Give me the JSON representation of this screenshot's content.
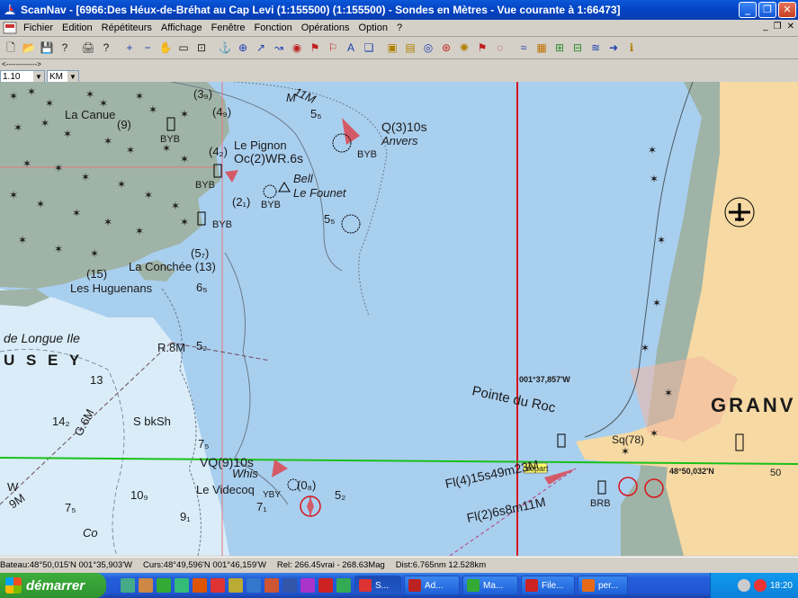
{
  "window": {
    "title": "ScanNav - [6966:Des Héux-de-Bréhat au Cap Levi (1:155500) (1:155500) - Sondes en  Mètres  - Vue courante à 1:66473]",
    "min_glyph": "_",
    "max_glyph": "❐",
    "close_glyph": "✕"
  },
  "menu": {
    "items": [
      "Fichier",
      "Edition",
      "Répétiteurs",
      "Affichage",
      "Fenêtre",
      "Fonction",
      "Opérations",
      "Option",
      "?"
    ],
    "mdi_min": "_",
    "mdi_restore": "❐",
    "mdi_close": "✕"
  },
  "toolbar": {
    "icons": [
      "new-chart-icon",
      "open-chart-icon",
      "save-icon",
      "help-icon",
      "print-icon",
      "pointer-help-icon",
      "zoom-in-icon",
      "zoom-out-icon",
      "hand-icon",
      "select-rect-icon",
      "select-zoom-icon",
      "boat-icon",
      "crosshair-icon",
      "route-icon",
      "track-icon",
      "mark-icon",
      "waypoint-icon",
      "waypoint2-icon",
      "text-icon",
      "layers-icon",
      "gps-icon",
      "nmea-icon",
      "compass-icon",
      "target-icon",
      "rose-icon",
      "flag-icon",
      "lifebuoy-icon",
      "tides-icon",
      "chart-icon",
      "grid-icon",
      "grid2-icon",
      "wind-icon",
      "arrow-icon",
      "info-icon"
    ]
  },
  "scale": {
    "ruler_label": "<------------->",
    "zoom_value": "1.10",
    "unit_value": "KM"
  },
  "map": {
    "labels": {
      "la_canue": "La Canue",
      "la_canue_depth": "(9)",
      "le_pignon": "Le Pignon",
      "oc_light": "Oc(2)WR.6s",
      "bell": "Bell",
      "le_founet": "Le Founet",
      "q_light": "Q(3)10s",
      "anvers": "Anvers",
      "byb_1": "BYB",
      "byb_2": "BYB",
      "byb_3": "BYB",
      "byb_4": "BYB",
      "byb_5": "BYB",
      "la_conchee": "La Conchée (13)",
      "les_huguenans": "Les Huguenans",
      "huguenans_depth": "(15)",
      "de_longue_ile": "de Longue Ile",
      "chausey": "U S E Y",
      "r8m": "R.8M",
      "g6m": "G.6M",
      "s_bksh": "S bkSh",
      "vq_light": "VQ(9)10s",
      "whis": "Whis",
      "le_videcoq": "Le Videcoq",
      "ybv": "YBY",
      "pointe_du_roc": "Pointe du Roc",
      "sq": "Sq(78)",
      "fl4": "Fl(4)15s49m23M",
      "fl2": "Fl(2)6s8m11M",
      "brb": "BRB",
      "depart": "départ",
      "granville": "GRANV",
      "lon_readout": "001°37,857'W",
      "lat_readout": "48°50,032'N",
      "w9m": "9M",
      "w_letter": "W",
      "co": "Co",
      "depth_75": "7₅",
      "depth_13": "13",
      "depth_14": "14₂",
      "depth_10": "10₉",
      "depth_91": "9₁",
      "depth_71": "7₁",
      "depth_52a": "5₂",
      "depth_52b": "5₂",
      "depth_08": "(0₈)",
      "depth_75b": "7₅",
      "depth_39": "(3₉)",
      "depth_49": "(4₉)",
      "depth_42": "(4₂)",
      "depth_21": "(2₁)",
      "depth_57": "(5₇)",
      "depth_55a": "5₅",
      "depth_55b": "5₅",
      "depth_65": "6₅",
      "depth_50": "50",
      "m_11": "11M",
      "m_letter": "M"
    }
  },
  "status": {
    "bateau": "Bateau:48°50,015'N 001°35,903'W",
    "curs": "Curs:48°49,596'N 001°46,159'W",
    "rel": "Rel: 266.45vrai - 268.63Mag",
    "dist": "Dist:6.765nm  12.528km"
  },
  "taskbar": {
    "start_label": "démarrer",
    "tasks": [
      "S...",
      "Ad...",
      "Ma...",
      "File...",
      "per..."
    ],
    "clock": "18:20"
  },
  "colors": {
    "sea_deep": "#a9cfef",
    "sea_shallow": "#d9ecf8",
    "land": "#f6d9a3",
    "foreshore": "#9fb3a6",
    "meridian": "#d8141b",
    "parallel": "#19c019"
  }
}
